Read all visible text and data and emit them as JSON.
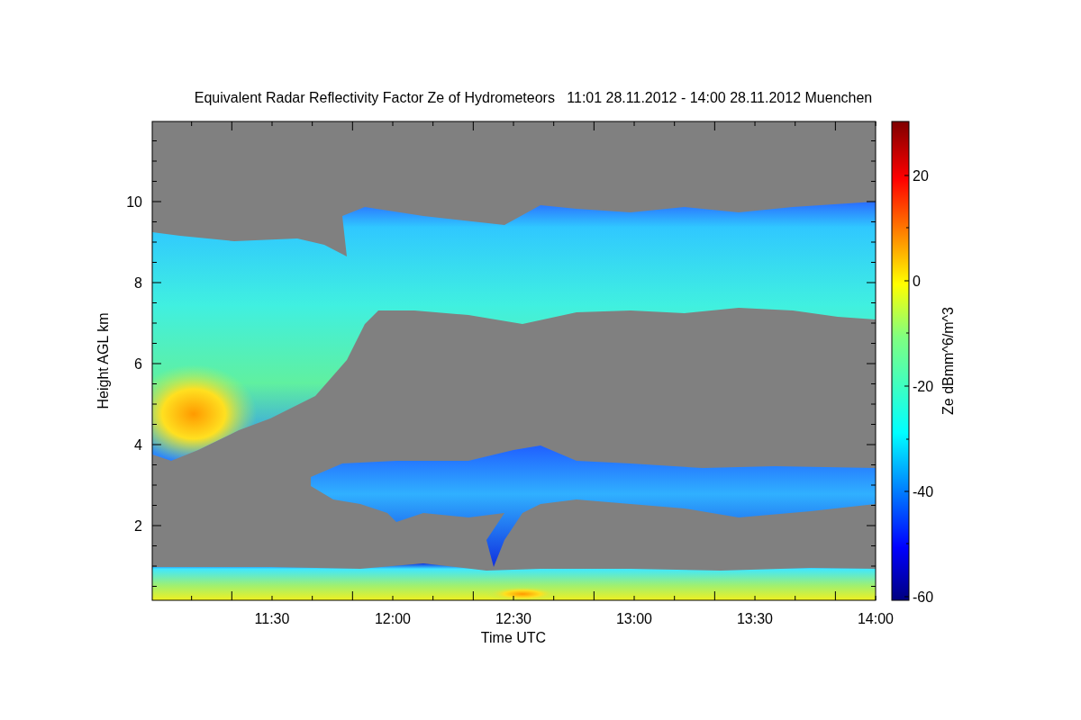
{
  "title": "Equivalent Radar Reflectivity Factor Ze of Hydrometeors   11:01 28.11.2012 - 14:00 28.11.2012 Muenchen",
  "y_axis": {
    "label": "Height AGL km",
    "ticks": [
      "10",
      "8",
      "6",
      "4",
      "2"
    ]
  },
  "x_axis": {
    "label": "Time UTC",
    "ticks": [
      "11:30",
      "12:00",
      "12:30",
      "13:00",
      "13:30",
      "14:00"
    ]
  },
  "colorbar": {
    "label": "Ze dBmm^6/m^3",
    "ticks": [
      "20",
      "0",
      "-20",
      "-40",
      "-60"
    ]
  }
}
